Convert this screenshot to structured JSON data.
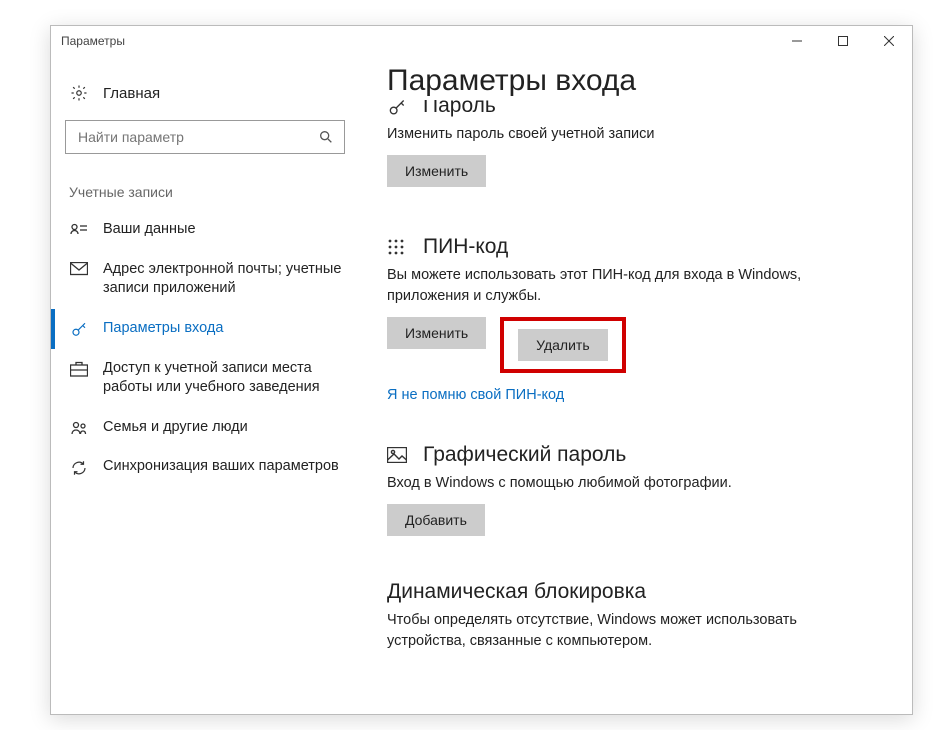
{
  "window": {
    "title": "Параметры"
  },
  "sidebar": {
    "home": "Главная",
    "search_placeholder": "Найти параметр",
    "group": "Учетные записи",
    "items": [
      {
        "label": "Ваши данные"
      },
      {
        "label": "Адрес электронной почты; учетные записи приложений"
      },
      {
        "label": "Параметры входа"
      },
      {
        "label": "Доступ к учетной записи места работы или учебного заведения"
      },
      {
        "label": "Семья и другие люди"
      },
      {
        "label": "Синхронизация ваших параметров"
      }
    ]
  },
  "main": {
    "title": "Параметры входа",
    "password": {
      "heading": "Пароль",
      "desc": "Изменить пароль своей учетной записи",
      "change": "Изменить"
    },
    "pin": {
      "heading": "ПИН-код",
      "desc": "Вы можете использовать этот ПИН-код для входа в Windows, приложения и службы.",
      "change": "Изменить",
      "delete": "Удалить",
      "forgot": "Я не помню свой ПИН-код"
    },
    "picture": {
      "heading": "Графический пароль",
      "desc": "Вход в Windows с помощью любимой фотографии.",
      "add": "Добавить"
    },
    "dynamic": {
      "heading": "Динамическая блокировка",
      "desc": "Чтобы определять отсутствие, Windows может использовать устройства, связанные с компьютером."
    }
  }
}
